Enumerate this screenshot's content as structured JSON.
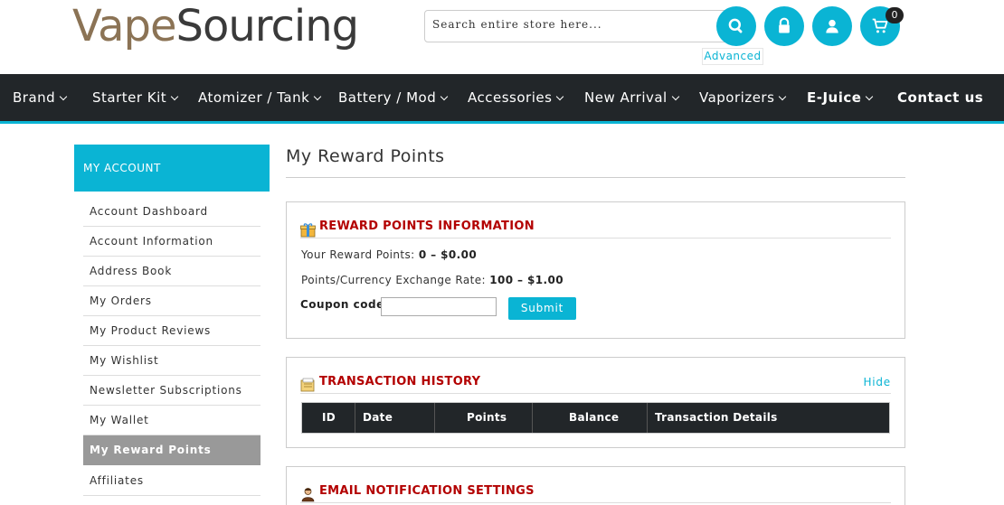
{
  "logo": {
    "part1": "Vape",
    "part2": "Sourcing"
  },
  "search": {
    "placeholder": "Search entire store here...",
    "advanced_label": "Advanced"
  },
  "header_icons": [
    "search-icon",
    "lock-icon",
    "user-icon",
    "cart-icon"
  ],
  "cart": {
    "count": "0"
  },
  "colors": {
    "accent": "#0ab4d4",
    "nav_bg": "#222629",
    "section_title": "#b30000",
    "active_sidebar": "#999999"
  },
  "nav": {
    "items": [
      {
        "label": "Brand",
        "has_dropdown": true
      },
      {
        "label": "Starter Kit",
        "has_dropdown": true
      },
      {
        "label": "Atomizer / Tank",
        "has_dropdown": true
      },
      {
        "label": "Battery / Mod",
        "has_dropdown": true
      },
      {
        "label": "Accessories",
        "has_dropdown": true
      },
      {
        "label": "New Arrival",
        "has_dropdown": true
      },
      {
        "label": "Vaporizers",
        "has_dropdown": true
      },
      {
        "label": "E-Juice",
        "has_dropdown": true
      },
      {
        "label": "Contact us",
        "has_dropdown": false
      }
    ]
  },
  "sidebar": {
    "title": "MY ACCOUNT",
    "items": [
      {
        "label": "Account Dashboard",
        "active": false
      },
      {
        "label": "Account Information",
        "active": false
      },
      {
        "label": "Address Book",
        "active": false
      },
      {
        "label": "My Orders",
        "active": false
      },
      {
        "label": "My Product Reviews",
        "active": false
      },
      {
        "label": "My Wishlist",
        "active": false
      },
      {
        "label": "Newsletter Subscriptions",
        "active": false
      },
      {
        "label": "My Wallet",
        "active": false
      },
      {
        "label": "My Reward Points",
        "active": true
      },
      {
        "label": "Affiliates",
        "active": false
      }
    ]
  },
  "main": {
    "title": "My Reward Points",
    "rewards": {
      "heading": "REWARD POINTS INFORMATION",
      "your_points_label": "Your Reward Points:",
      "your_points_value": "0 – $0.00",
      "rate_label": "Points/Currency Exchange Rate:",
      "rate_value": "100 – $1.00",
      "coupon_label": "Coupon code:",
      "coupon_value": "",
      "submit_label": "Submit"
    },
    "transactions": {
      "heading": "TRANSACTION HISTORY",
      "hide_label": "Hide",
      "columns": [
        "ID",
        "Date",
        "Points",
        "Balance",
        "Transaction Details"
      ]
    },
    "email": {
      "heading": "EMAIL NOTIFICATION SETTINGS"
    }
  }
}
